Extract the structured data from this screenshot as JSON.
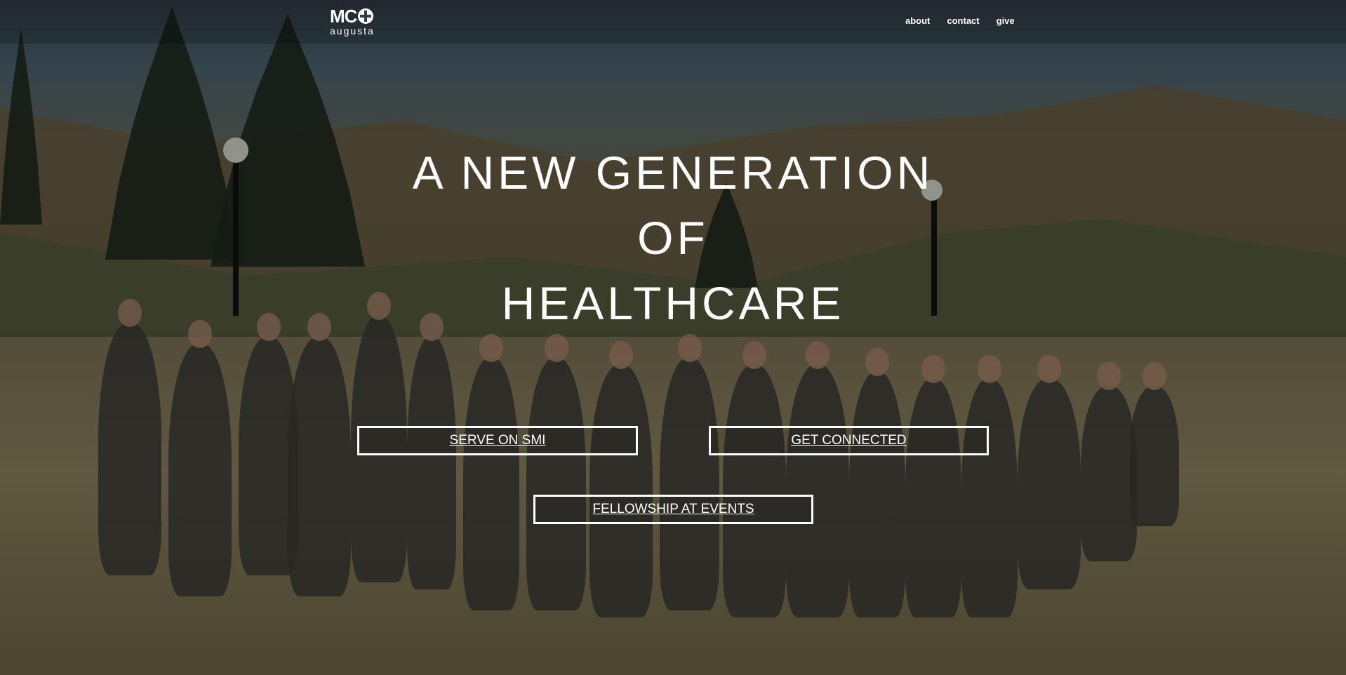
{
  "nav": {
    "logo_main": "MC",
    "logo_sub": "augusta",
    "links": [
      "about",
      "contact",
      "give"
    ]
  },
  "hero": {
    "headline_lines": [
      "A NEW GENERATION",
      "OF",
      "HEALTHCARE"
    ]
  },
  "buttons": {
    "serve": "SERVE ON SMI",
    "connect": "GET CONNECTED",
    "fellowship": "FELLOWSHIP AT EVENTS"
  },
  "colors": {
    "text": "#ffffff",
    "button_border": "#ffffff"
  }
}
